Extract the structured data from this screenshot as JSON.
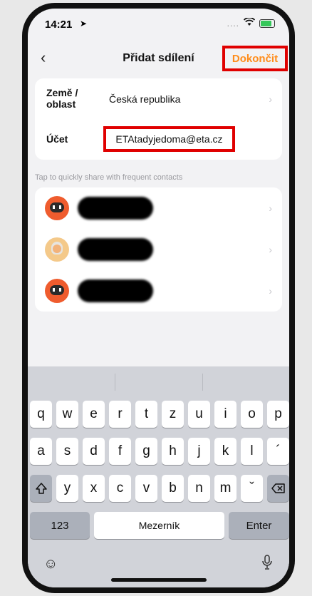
{
  "status_bar": {
    "time": "14:21",
    "location_icon": "location-arrow-icon",
    "signal": "....",
    "wifi_icon": "wifi-icon",
    "battery_icon": "battery-charging-icon"
  },
  "nav": {
    "back_icon": "chevron-left-icon",
    "title": "Přidat sdílení",
    "done_label": "Dokončit"
  },
  "form": {
    "region_label": "Země / oblast",
    "region_value": "Česká republika",
    "account_label": "Účet",
    "account_value": "ETAtadyjedoma@eta.cz"
  },
  "hint": "Tap to quickly share with frequent contacts",
  "contacts": [
    {
      "avatar": "robot-avatar",
      "name_redacted": true
    },
    {
      "avatar": "person-avatar",
      "name_redacted": true
    },
    {
      "avatar": "robot-avatar",
      "name_redacted": true
    }
  ],
  "keyboard": {
    "row1": [
      "q",
      "w",
      "e",
      "r",
      "t",
      "z",
      "u",
      "i",
      "o",
      "p"
    ],
    "row2": [
      "a",
      "s",
      "d",
      "f",
      "g",
      "h",
      "j",
      "k",
      "l",
      "´"
    ],
    "row3": [
      "y",
      "x",
      "c",
      "v",
      "b",
      "n",
      "m",
      "ˇ"
    ],
    "shift_icon": "shift-icon",
    "delete_icon": "backspace-icon",
    "numbers_label": "123",
    "space_label": "Mezerník",
    "enter_label": "Enter",
    "emoji_icon": "emoji-icon",
    "mic_icon": "microphone-icon"
  }
}
